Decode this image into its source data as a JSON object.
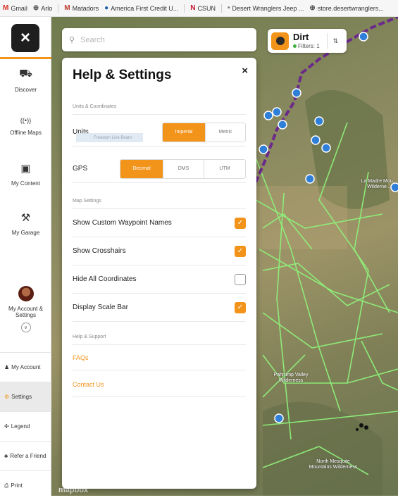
{
  "bookmarks": [
    {
      "icon": "M",
      "label": "Gmail",
      "color": "#d93025"
    },
    {
      "icon": "⊕",
      "label": "Arlo",
      "color": "#555555"
    },
    {
      "icon": "M",
      "label": "Matadors",
      "color": "#c0392b"
    },
    {
      "icon": "●",
      "label": "America First Credit U...",
      "color": "#1f5fa8"
    },
    {
      "icon": "N",
      "label": "CSUN",
      "color": "#c8102e"
    },
    {
      "icon": "•",
      "label": "Desert Wranglers Jeep ...",
      "color": "#777777"
    },
    {
      "icon": "⊕",
      "label": "store.desertwranglers...",
      "color": "#555555"
    }
  ],
  "sidebar": {
    "close_icon": "×",
    "items": [
      {
        "label": "Discover",
        "icon": "binoculars-icon",
        "glyph": "⛟"
      },
      {
        "label": "Offline Maps",
        "icon": "signal-icon",
        "glyph": "((•))"
      },
      {
        "label": "My Content",
        "icon": "folder-icon",
        "glyph": "▣"
      },
      {
        "label": "My Garage",
        "icon": "wrench-icon",
        "glyph": "⚒"
      }
    ],
    "account": {
      "label_line1": "My Account &",
      "label_line2": "Settings",
      "chevron": "∨"
    },
    "menu": [
      {
        "label": "My Account",
        "glyph": "♟"
      },
      {
        "label": "Settings",
        "glyph": "⚙"
      },
      {
        "label": "Legend",
        "glyph": "✣"
      },
      {
        "label": "Refer a Friend",
        "glyph": "♣"
      },
      {
        "label": "Print",
        "glyph": "⎙"
      }
    ]
  },
  "search": {
    "placeholder": "Search",
    "icon": "search-icon"
  },
  "filter_pill": {
    "title": "Dirt",
    "filters": "Filters: 1",
    "sort_glyph": "⇅"
  },
  "panel": {
    "title": "Help & Settings",
    "close": "×",
    "units_section": "Units & Coordinates",
    "units_label": "Units",
    "units_options": [
      "Imperial",
      "Metric"
    ],
    "units_selected": "Imperial",
    "tooltip": "Freedom Live Beam",
    "gps_label": "GPS",
    "gps_options": [
      "Decimal",
      "DMS",
      "UTM"
    ],
    "gps_selected": "Decimal",
    "map_section": "Map Settings",
    "toggles": [
      {
        "label": "Show Custom Waypoint Names",
        "checked": true
      },
      {
        "label": "Show Crosshairs",
        "checked": true
      },
      {
        "label": "Hide All Coordinates",
        "checked": false
      },
      {
        "label": "Display Scale Bar",
        "checked": true
      }
    ],
    "help_section": "Help & Support",
    "faq": "FAQs",
    "contact": "Contact Us"
  },
  "map_labels": {
    "madre": "La Madre Mou... Wilderne...",
    "pahrump": "Pahrump Valley Wilderness",
    "mesquite": "North Mesquite Mountains Wilderness",
    "mapbox": "mapbox"
  },
  "colors": {
    "accent": "#f2931a",
    "trail": "#8ff07a",
    "route": "#6b2a8a",
    "pin": "#2f7ed8"
  }
}
